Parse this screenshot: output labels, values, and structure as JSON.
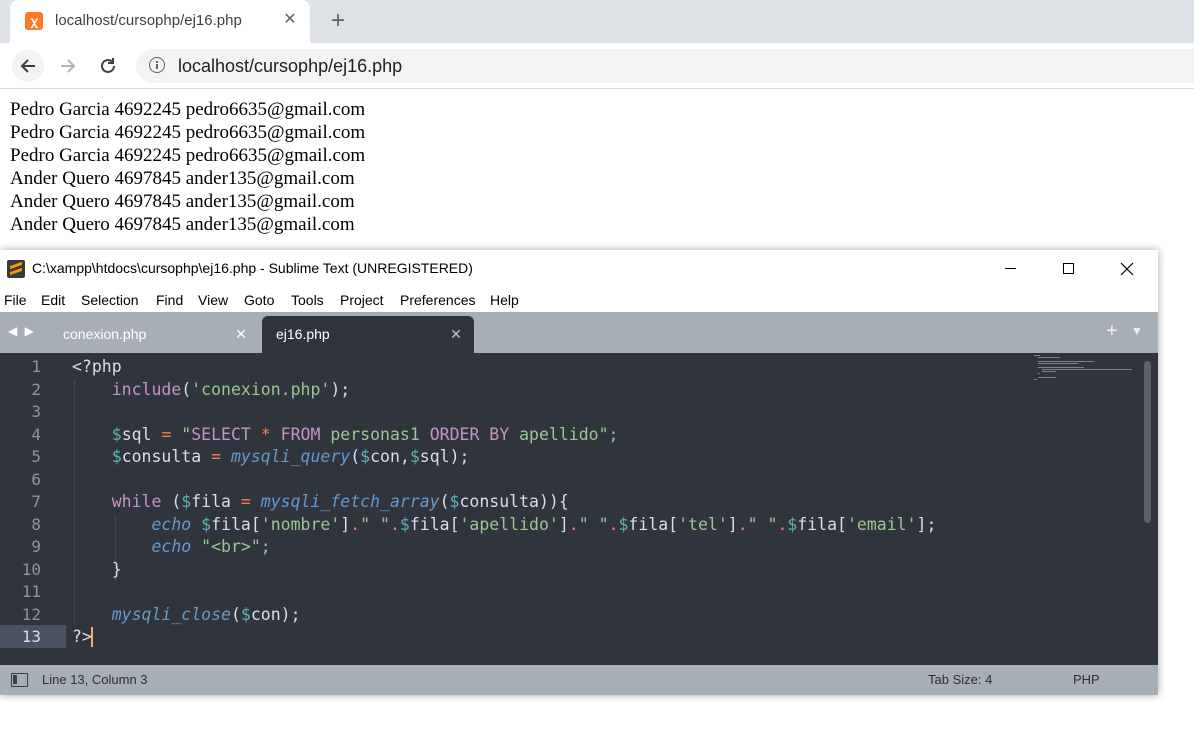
{
  "browser": {
    "tab_title": "localhost/cursophp/ej16.php",
    "tab_close": "✕",
    "new_tab": "+",
    "url": "localhost/cursophp/ej16.php",
    "icons": {
      "favicon": "xampp-icon",
      "back": "back-arrow-icon",
      "forward": "forward-arrow-icon",
      "reload": "reload-icon",
      "info": "info-icon"
    }
  },
  "page": {
    "lines": [
      "Pedro Garcia 4692245 pedro6635@gmail.com",
      "Pedro Garcia 4692245 pedro6635@gmail.com",
      "Pedro Garcia 4692245 pedro6635@gmail.com",
      "Ander Quero 4697845 ander135@gmail.com",
      "Ander Quero 4697845 ander135@gmail.com",
      "Ander Quero 4697845 ander135@gmail.com"
    ]
  },
  "sublime": {
    "window_title": "C:\\xampp\\htdocs\\cursophp\\ej16.php - Sublime Text (UNREGISTERED)",
    "menu": [
      "File",
      "Edit",
      "Selection",
      "Find",
      "View",
      "Goto",
      "Tools",
      "Project",
      "Preferences",
      "Help"
    ],
    "tabs": [
      {
        "label": "conexion.php",
        "active": false
      },
      {
        "label": "ej16.php",
        "active": true
      }
    ],
    "tab_close": "✕",
    "line_numbers": [
      "1",
      "2",
      "3",
      "4",
      "5",
      "6",
      "7",
      "8",
      "9",
      "10",
      "11",
      "12",
      "13"
    ],
    "current_line": "13",
    "code": {
      "l1": {
        "a": "<?php"
      },
      "l2": {
        "a": "include",
        "b": "(",
        "c": "'conexion.php'",
        "d": ");"
      },
      "l4": {
        "a": "$",
        "b": "sql",
        "c": " ",
        "d": "=",
        "e": " \"",
        "f": "SELECT",
        "g": " ",
        "h": "*",
        "i": " ",
        "j": "FROM",
        "k": " personas1 ",
        "l": "ORDER BY",
        "m": " apellido",
        "n": "\";"
      },
      "l5": {
        "a": "$",
        "b": "consulta",
        "c": " ",
        "d": "=",
        "e": " ",
        "f": "mysqli_query",
        "g": "(",
        "h": "$",
        "i": "con,",
        "j": "$",
        "k": "sql);"
      },
      "l7": {
        "a": "while",
        "b": " (",
        "c": "$",
        "d": "fila",
        "e": " ",
        "f": "=",
        "g": " ",
        "h": "mysqli_fetch_array",
        "i": "(",
        "j": "$",
        "k": "consulta)){"
      },
      "l8": {
        "a": "echo",
        "b": " ",
        "c": "$",
        "d": "fila[",
        "e": "'nombre'",
        "f": "]",
        "g": ".",
        "h": "\" \"",
        "i": ".",
        "j": "$",
        "k": "fila[",
        "l": "'apellido'",
        "m": "]",
        "n": ".",
        "o": "\" \"",
        "p": ".",
        "q": "$",
        "r": "fila[",
        "s": "'tel'",
        "t": "]",
        "u": ".",
        "v": "\" \"",
        "w": ".",
        "x": "$",
        "y": "fila[",
        "z": "'email'",
        "z2": "];"
      },
      "l9": {
        "a": "echo",
        "b": " \"",
        "c": "<br>",
        "d": "\";"
      },
      "l10": {
        "a": "}"
      },
      "l12": {
        "a": "mysqli_close",
        "b": "(",
        "c": "$",
        "d": "con);"
      },
      "l13": {
        "a": "?>"
      }
    },
    "status": {
      "position": "Line 13, Column 3",
      "tab_size": "Tab Size: 4",
      "syntax": "PHP"
    },
    "colors": {
      "editor_bg": "#30353d",
      "tabbar_bg": "#a8aeb5",
      "string": "#99c794",
      "variable": "#5fb3b3",
      "operator": "#f97b58",
      "keyword": "#c594c5",
      "function": "#6699cc",
      "cursor": "#f9ae58"
    }
  }
}
